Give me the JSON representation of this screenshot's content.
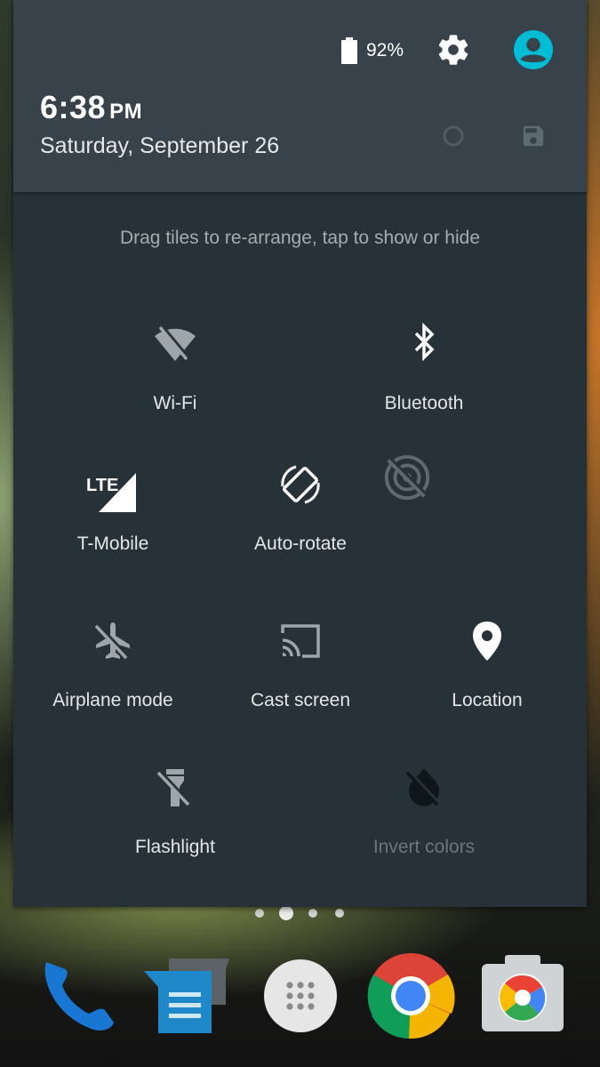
{
  "status": {
    "battery_percent": "92%",
    "battery_icon": "battery-icon",
    "settings_icon": "gear-icon",
    "user_icon": "account-circle-icon",
    "accent_color": "#00bcd4"
  },
  "header": {
    "time": "6:38",
    "ampm": "PM",
    "date": "Saturday, September 26"
  },
  "edit_hint": "Drag tiles to re-arrange, tap to show or hide",
  "tiles": [
    {
      "label": "Wi-Fi",
      "icon": "wifi-off-icon",
      "enabled": false
    },
    {
      "label": "Bluetooth",
      "icon": "bluetooth-icon",
      "enabled": true
    },
    {
      "label": "T-Mobile",
      "icon": "lte-signal-icon",
      "enabled": true
    },
    {
      "label": "Auto-rotate",
      "icon": "auto-rotate-icon",
      "enabled": true
    },
    {
      "label": "",
      "icon": "hotspot-off-icon",
      "enabled": false
    },
    {
      "label": "Airplane mode",
      "icon": "airplane-icon",
      "enabled": false
    },
    {
      "label": "Cast screen",
      "icon": "cast-icon",
      "enabled": false
    },
    {
      "label": "Location",
      "icon": "location-pin-icon",
      "enabled": true
    },
    {
      "label": "Flashlight",
      "icon": "flashlight-off-icon",
      "enabled": false
    },
    {
      "label": "Invert colors",
      "icon": "invert-colors-off-icon",
      "enabled": false
    }
  ],
  "pager": {
    "count": 4,
    "current": 2
  },
  "dock": [
    "phone-icon",
    "messaging-icon",
    "app-drawer-icon",
    "chrome-icon",
    "camera-icon"
  ]
}
